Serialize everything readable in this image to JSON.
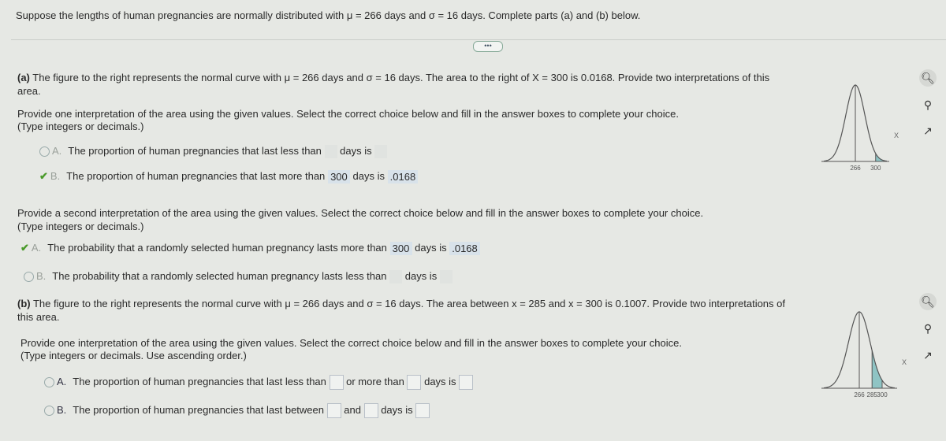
{
  "header": {
    "prompt": "Suppose the lengths of human pregnancies are normally distributed with μ = 266 days and σ = 16 days. Complete parts (a) and (b) below."
  },
  "more_button": "•••",
  "part_a": {
    "label": "(a)",
    "text": " The figure to the right represents the normal curve with μ = 266 days and σ = 16 days. The area to the right of X = 300 is 0.0168. Provide two interpretations of this",
    "text2": "area.",
    "q1": "Provide one interpretation of the area using the given values. Select the correct choice below and fill in the answer boxes to complete your choice.",
    "q1_hint": "(Type integers or decimals.)",
    "q1_options": [
      {
        "letter": "A.",
        "pre": "The proportion of human pregnancies that last less than",
        "mid": "days is",
        "v1": "",
        "v2": "",
        "selected": false
      },
      {
        "letter": "B.",
        "pre": "The proportion of human pregnancies that last more than",
        "mid": "days is",
        "v1": "300",
        "v2": ".0168",
        "selected": true
      }
    ],
    "q2": "Provide a second interpretation of the area using the given values. Select the correct choice below and fill in the answer boxes to complete your choice.",
    "q2_hint": "(Type integers or decimals.)",
    "q2_options": [
      {
        "letter": "A.",
        "pre": "The probability that a randomly selected human pregnancy lasts more than",
        "mid": "days is",
        "v1": "300",
        "v2": ".0168",
        "selected": true
      },
      {
        "letter": "B.",
        "pre": "The probability that a randomly selected human pregnancy lasts less than",
        "mid": "days is",
        "v1": "",
        "v2": "",
        "selected": false
      }
    ],
    "figure": {
      "mu": 266,
      "sigma": 16,
      "shade_from": 300,
      "shade_to": null,
      "ticks": [
        "266",
        "300"
      ],
      "axis_label": "X",
      "shade_color": "#8fc4c4"
    }
  },
  "part_b": {
    "label": "(b)",
    "text": " The figure to the right represents the normal curve with μ = 266 days and σ = 16 days. The area between x = 285 and x = 300 is 0.1007. Provide two interpretations of",
    "text2": "this area.",
    "q1": "Provide one interpretation of the area using the given values. Select the correct choice below and fill in the answer boxes to complete your choice.",
    "q1_hint": "(Type integers or decimals. Use ascending order.)",
    "optA": {
      "letter": "A.",
      "pre": "The proportion of human pregnancies that last less than",
      "mid": "or more than",
      "post": "days is"
    },
    "optB": {
      "letter": "B.",
      "pre": "The proportion of human pregnancies that last between",
      "mid": "and",
      "post": "days is"
    },
    "figure": {
      "mu": 266,
      "sigma": 16,
      "shade_from": 285,
      "shade_to": 300,
      "ticks": [
        "266",
        "285",
        "300"
      ],
      "axis_label": "X",
      "shade_color": "#8fc4c4"
    }
  },
  "icons": [
    "zoom-in-icon",
    "zoom-out-icon",
    "popout-icon"
  ]
}
